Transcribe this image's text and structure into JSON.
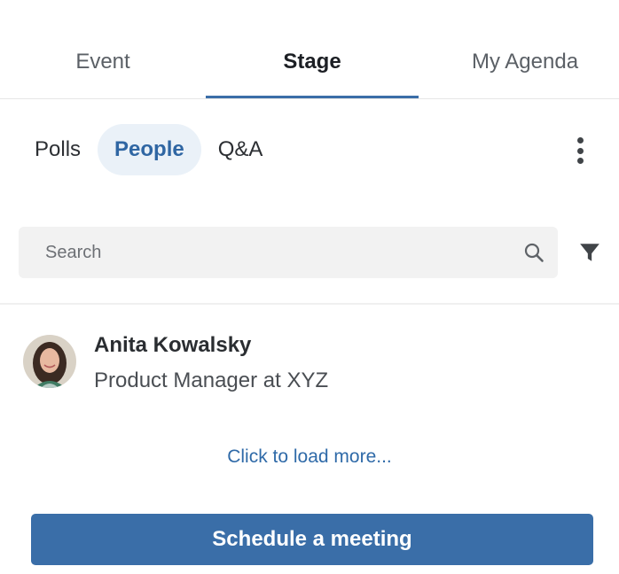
{
  "tabs": [
    {
      "label": "Event",
      "active": false
    },
    {
      "label": "Stage",
      "active": true
    },
    {
      "label": "My Agenda",
      "active": false
    }
  ],
  "subtabs": [
    {
      "label": "Polls",
      "active": false
    },
    {
      "label": "People",
      "active": true
    },
    {
      "label": "Q&A",
      "active": false
    }
  ],
  "search": {
    "placeholder": "Search",
    "value": ""
  },
  "people": [
    {
      "name": "Anita Kowalsky",
      "title": "Product Manager at XYZ"
    }
  ],
  "load_more": "Click to load more...",
  "cta_label": "Schedule a meeting",
  "colors": {
    "accent": "#3a6ea8",
    "active_pill_bg": "#eaf1f8",
    "search_bg": "#f2f2f2"
  },
  "icons": {
    "more": "vertical-dots-icon",
    "search": "search-icon",
    "filter": "filter-icon"
  }
}
